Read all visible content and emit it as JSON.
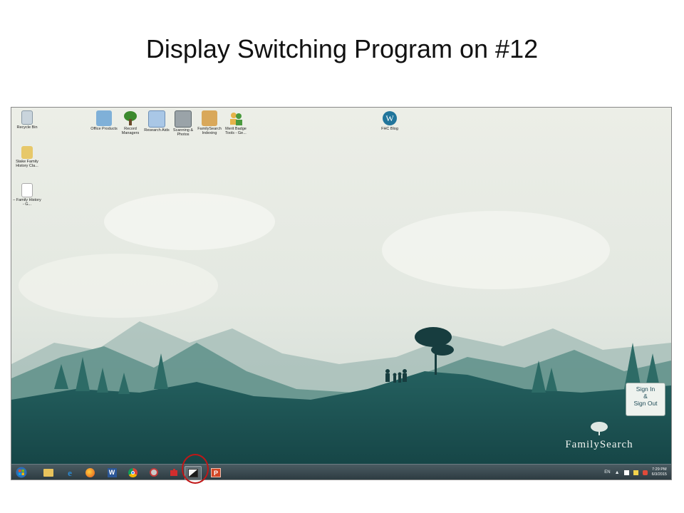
{
  "slide": {
    "title": "Display Switching Program on #12"
  },
  "desktop": {
    "icons": [
      {
        "label": "Recycle Bin",
        "icon": "recycle-bin-icon"
      },
      {
        "label": "Stake Family History Cla...",
        "icon": "folder-icon"
      },
      {
        "label": "– Family History - G...",
        "icon": "shortcut-file-icon"
      },
      {
        "label": "Office Products",
        "icon": "office-icon"
      },
      {
        "label": "Record Managers",
        "icon": "tree-icon"
      },
      {
        "label": "Research Aids",
        "icon": "research-icon"
      },
      {
        "label": "Scanning & Photos",
        "icon": "scanner-icon"
      },
      {
        "label": "FamilySearch Indexing",
        "icon": "indexing-icon"
      },
      {
        "label": "Merit Badge Tools - Ge...",
        "icon": "users-icon"
      },
      {
        "label": "FHC Blog",
        "icon": "wordpress-icon"
      }
    ]
  },
  "signin": {
    "line1": "Sign In",
    "line2": "&",
    "line3": "Sign Out"
  },
  "brand": {
    "logo_text": "FamilySearch"
  },
  "taskbar": {
    "items": [
      {
        "name": "start-button"
      },
      {
        "name": "explorer"
      },
      {
        "name": "internet-explorer"
      },
      {
        "name": "firefox"
      },
      {
        "name": "word"
      },
      {
        "name": "chrome"
      },
      {
        "name": "tools"
      },
      {
        "name": "puzzle"
      },
      {
        "name": "display-switch",
        "active": true
      },
      {
        "name": "powerpoint"
      }
    ],
    "tray": {
      "lang": "EN",
      "time": "7:29 PM",
      "date": "6/3/2015"
    }
  },
  "colors": {
    "highlight": "#c01717",
    "sky": "#e9ebe4",
    "hills": "#1f5c5c",
    "taskbar": "#33444a"
  }
}
